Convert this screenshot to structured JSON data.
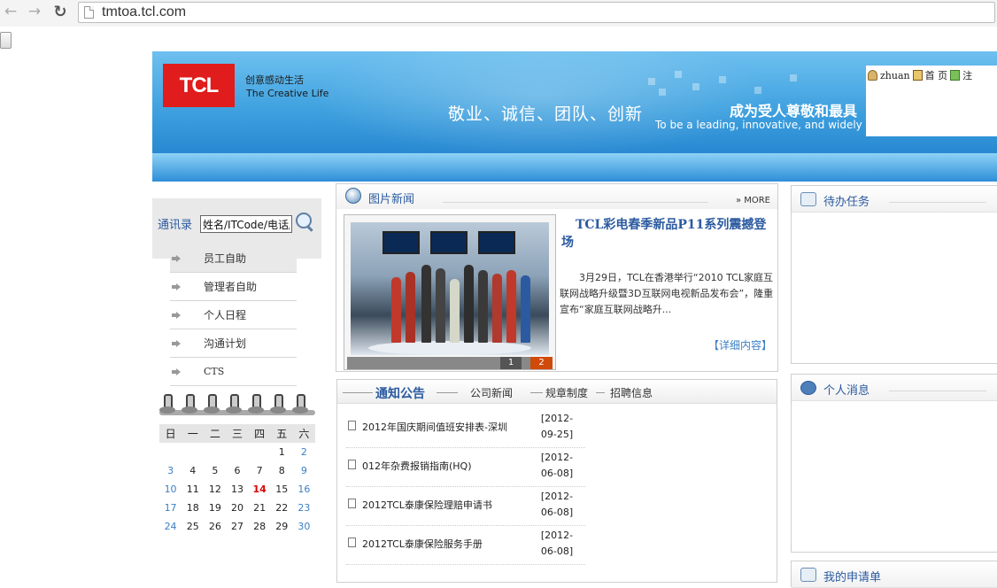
{
  "browser": {
    "url": "tmtoa.tcl.com"
  },
  "banner": {
    "logo_text": "TCL",
    "slogan_cn": "创意感动生活",
    "slogan_en": "The Creative Life",
    "motto": "敬业、诚信、团队、创新",
    "vision_cn": "成为受人尊敬和最具",
    "vision_en": "To be a leading, innovative, and widely"
  },
  "userbar": {
    "username": "zhuan",
    "home_label": "首 页",
    "logout_label": "注"
  },
  "sidebar": {
    "search_label": "通讯录",
    "search_value": "姓名/ITCode/电话/",
    "menu": [
      "员工自助",
      "管理者自助",
      "个人日程",
      "沟通计划",
      "CTS"
    ]
  },
  "calendar": {
    "weekdays": [
      "日",
      "一",
      "二",
      "三",
      "四",
      "五",
      "六"
    ],
    "today": "14",
    "weeks": [
      [
        "",
        "",
        "",
        "",
        "",
        "1",
        "2"
      ],
      [
        "3",
        "4",
        "5",
        "6",
        "7",
        "8",
        "9"
      ],
      [
        "10",
        "11",
        "12",
        "13",
        "14",
        "15",
        "16"
      ],
      [
        "17",
        "18",
        "19",
        "20",
        "21",
        "22",
        "23"
      ],
      [
        "24",
        "25",
        "26",
        "27",
        "28",
        "29",
        "30"
      ]
    ]
  },
  "photo_news": {
    "title": "图片新闻",
    "more": "MORE",
    "headline": "TCL彩电春季新品P11系列震撼登场",
    "summary": "3月29日，TCL在香港举行“2010 TCL家庭互联网战略升级暨3D互联网电视新品发布会”，隆重宣布“家庭互联网战略升...",
    "detail_link": "【详细内容】",
    "pages": [
      "1",
      "2"
    ]
  },
  "notices": {
    "tabs": [
      "通知公告",
      "公司新闻",
      "规章制度",
      "招聘信息"
    ],
    "items": [
      {
        "title": "2012年国庆期间值班安排表-深圳",
        "date": "[2012-09-25]"
      },
      {
        "title": "012年杂费报销指南(HQ)",
        "date": "[2012-06-08]"
      },
      {
        "title": "2012TCL泰康保险理赔申请书",
        "date": "[2012-06-08]"
      },
      {
        "title": "2012TCL泰康保险服务手册",
        "date": "[2012-06-08]"
      }
    ]
  },
  "right_panels": {
    "todo_title": "待办任务",
    "messages_title": "个人消息",
    "requests_title": "我的申请单"
  }
}
